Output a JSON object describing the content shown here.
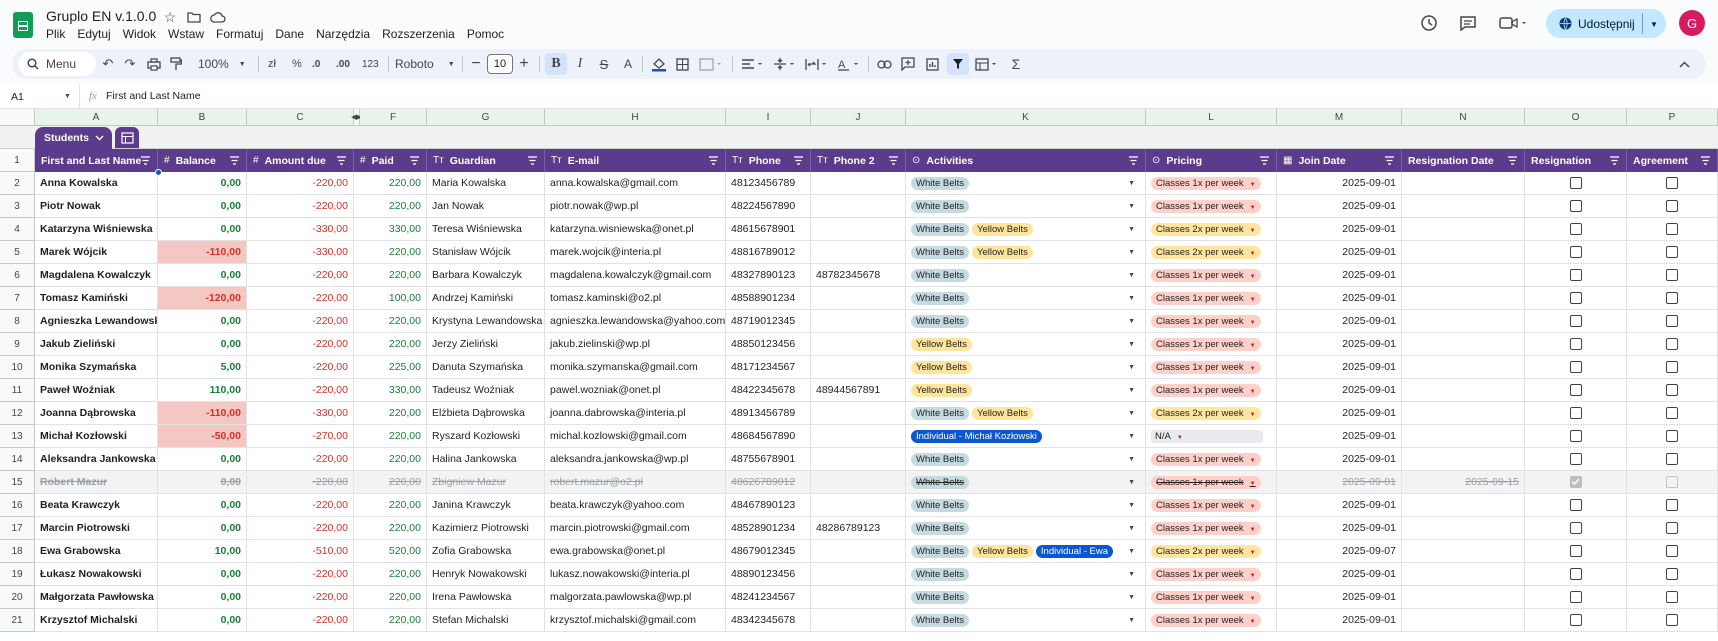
{
  "app": {
    "title": "Gruplo EN v.1.0.0",
    "share_label": "Udostępnij",
    "avatar_letter": "G",
    "menu": [
      "Plik",
      "Edytuj",
      "Widok",
      "Wstaw",
      "Formatuj",
      "Dane",
      "Narzędzia",
      "Rozszerzenia",
      "Pomoc"
    ]
  },
  "toolbar": {
    "search_label": "Menu",
    "zoom": "100%",
    "font": "Roboto",
    "font_size": "10",
    "currency": "zł",
    "percent": "%",
    "dec_less": ".0",
    "dec_more": ".00",
    "number_format": "123"
  },
  "formula": {
    "cell_ref": "A1",
    "fx": "fx",
    "content": "First and Last Name"
  },
  "sheet_tab": {
    "label": "Students"
  },
  "col_letters": [
    "A",
    "B",
    "C",
    "",
    "F",
    "G",
    "H",
    "I",
    "J",
    "K",
    "L",
    "M",
    "N",
    "O",
    "P"
  ],
  "headers": [
    "First and Last Name",
    "Balance",
    "Amount due",
    "Paid",
    "Guardian",
    "E-mail",
    "Phone",
    "Phone 2",
    "Activities",
    "Pricing",
    "Join Date",
    "Resignation Date",
    "Resignation",
    "Agreement"
  ],
  "header_icons": [
    "",
    "#",
    "#",
    "#",
    "Tт",
    "Tт",
    "Tт",
    "Tт",
    "⊙",
    "⊙",
    "▦",
    "",
    "",
    ""
  ],
  "rows": [
    {
      "n": "2",
      "name": "Anna Kowalska",
      "bal": "0,00",
      "due": "-220,00",
      "paid": "220,00",
      "guard": "Maria Kowalska",
      "email": "anna.kowalska@gmail.com",
      "ph": "48123456789",
      "ph2": "",
      "acts": [
        "White Belts"
      ],
      "price": "Classes 1x per week",
      "join": "2025-09-01",
      "resig": ""
    },
    {
      "n": "3",
      "name": "Piotr Nowak",
      "bal": "0,00",
      "due": "-220,00",
      "paid": "220,00",
      "guard": "Jan Nowak",
      "email": "piotr.nowak@wp.pl",
      "ph": "48224567890",
      "ph2": "",
      "acts": [
        "White Belts"
      ],
      "price": "Classes 1x per week",
      "join": "2025-09-01",
      "resig": ""
    },
    {
      "n": "4",
      "name": "Katarzyna Wiśniewska",
      "bal": "0,00",
      "due": "-330,00",
      "paid": "330,00",
      "guard": "Teresa Wiśniewska",
      "email": "katarzyna.wisniewska@onet.pl",
      "ph": "48615678901",
      "ph2": "",
      "acts": [
        "White Belts",
        "Yellow Belts"
      ],
      "price": "Classes 2x per week",
      "join": "2025-09-01",
      "resig": ""
    },
    {
      "n": "5",
      "name": "Marek Wójcik",
      "bal": "-110,00",
      "due": "-330,00",
      "paid": "220,00",
      "guard": "Stanisław Wójcik",
      "email": "marek.wojcik@interia.pl",
      "ph": "48816789012",
      "ph2": "",
      "acts": [
        "White Belts",
        "Yellow Belts"
      ],
      "price": "Classes 2x per week",
      "join": "2025-09-01",
      "resig": ""
    },
    {
      "n": "6",
      "name": "Magdalena Kowalczyk",
      "bal": "0,00",
      "due": "-220,00",
      "paid": "220,00",
      "guard": "Barbara Kowalczyk",
      "email": "magdalena.kowalczyk@gmail.com",
      "ph": "48327890123",
      "ph2": "48782345678",
      "acts": [
        "White Belts"
      ],
      "price": "Classes 1x per week",
      "join": "2025-09-01",
      "resig": ""
    },
    {
      "n": "7",
      "name": "Tomasz Kamiński",
      "bal": "-120,00",
      "due": "-220,00",
      "paid": "100,00",
      "guard": "Andrzej Kamiński",
      "email": "tomasz.kaminski@o2.pl",
      "ph": "48588901234",
      "ph2": "",
      "acts": [
        "White Belts"
      ],
      "price": "Classes 1x per week",
      "join": "2025-09-01",
      "resig": ""
    },
    {
      "n": "8",
      "name": "Agnieszka Lewandowska",
      "bal": "0,00",
      "due": "-220,00",
      "paid": "220,00",
      "guard": "Krystyna Lewandowska",
      "email": "agnieszka.lewandowska@yahoo.com",
      "ph": "48719012345",
      "ph2": "",
      "acts": [
        "White Belts"
      ],
      "price": "Classes 1x per week",
      "join": "2025-09-01",
      "resig": ""
    },
    {
      "n": "9",
      "name": "Jakub Zieliński",
      "bal": "0,00",
      "due": "-220,00",
      "paid": "220,00",
      "guard": "Jerzy Zieliński",
      "email": "jakub.zielinski@wp.pl",
      "ph": "48850123456",
      "ph2": "",
      "acts": [
        "Yellow Belts"
      ],
      "price": "Classes 1x per week",
      "join": "2025-09-01",
      "resig": ""
    },
    {
      "n": "10",
      "name": "Monika Szymańska",
      "bal": "5,00",
      "due": "-220,00",
      "paid": "225,00",
      "guard": "Danuta Szymańska",
      "email": "monika.szymanska@gmail.com",
      "ph": "48171234567",
      "ph2": "",
      "acts": [
        "Yellow Belts"
      ],
      "price": "Classes 1x per week",
      "join": "2025-09-01",
      "resig": ""
    },
    {
      "n": "11",
      "name": "Paweł Woźniak",
      "bal": "110,00",
      "due": "-220,00",
      "paid": "330,00",
      "guard": "Tadeusz Woźniak",
      "email": "pawel.wozniak@onet.pl",
      "ph": "48422345678",
      "ph2": "48944567891",
      "acts": [
        "Yellow Belts"
      ],
      "price": "Classes 1x per week",
      "join": "2025-09-01",
      "resig": ""
    },
    {
      "n": "12",
      "name": "Joanna Dąbrowska",
      "bal": "-110,00",
      "due": "-330,00",
      "paid": "220,00",
      "guard": "Elżbieta Dąbrowska",
      "email": "joanna.dabrowska@interia.pl",
      "ph": "48913456789",
      "ph2": "",
      "acts": [
        "White Belts",
        "Yellow Belts"
      ],
      "price": "Classes 2x per week",
      "join": "2025-09-01",
      "resig": ""
    },
    {
      "n": "13",
      "name": "Michał Kozłowski",
      "bal": "-50,00",
      "due": "-270,00",
      "paid": "220,00",
      "guard": "Ryszard Kozłowski",
      "email": "michal.kozlowski@gmail.com",
      "ph": "48684567890",
      "ph2": "",
      "acts": [
        "Individual - Michał Kozłowski"
      ],
      "price": "N/A",
      "join": "2025-09-01",
      "resig": ""
    },
    {
      "n": "14",
      "name": "Aleksandra Jankowska",
      "bal": "0,00",
      "due": "-220,00",
      "paid": "220,00",
      "guard": "Halina Jankowska",
      "email": "aleksandra.jankowska@wp.pl",
      "ph": "48755678901",
      "ph2": "",
      "acts": [
        "White Belts"
      ],
      "price": "Classes 1x per week",
      "join": "2025-09-01",
      "resig": ""
    },
    {
      "n": "15",
      "name": "Robert Mazur",
      "bal": "0,00",
      "due": "-220,00",
      "paid": "220,00",
      "guard": "Zbigniew Mazur",
      "email": "robert.mazur@o2.pl",
      "ph": "48626789012",
      "ph2": "",
      "acts": [
        "White Belts"
      ],
      "price": "Classes 1x per week",
      "join": "2025-09-01",
      "resig": "2025-09-15",
      "struck": true
    },
    {
      "n": "16",
      "name": "Beata Krawczyk",
      "bal": "0,00",
      "due": "-220,00",
      "paid": "220,00",
      "guard": "Janina Krawczyk",
      "email": "beata.krawczyk@yahoo.com",
      "ph": "48467890123",
      "ph2": "",
      "acts": [
        "White Belts"
      ],
      "price": "Classes 1x per week",
      "join": "2025-09-01",
      "resig": ""
    },
    {
      "n": "17",
      "name": "Marcin Piotrowski",
      "bal": "0,00",
      "due": "-220,00",
      "paid": "220,00",
      "guard": "Kazimierz Piotrowski",
      "email": "marcin.piotrowski@gmail.com",
      "ph": "48528901234",
      "ph2": "48286789123",
      "acts": [
        "White Belts"
      ],
      "price": "Classes 1x per week",
      "join": "2025-09-01",
      "resig": ""
    },
    {
      "n": "18",
      "name": "Ewa Grabowska",
      "bal": "10,00",
      "due": "-510,00",
      "paid": "520,00",
      "guard": "Zofia Grabowska",
      "email": "ewa.grabowska@onet.pl",
      "ph": "48679012345",
      "ph2": "",
      "acts": [
        "White Belts",
        "Yellow Belts",
        "Individual - Ewa"
      ],
      "price": "Classes 2x per week",
      "join": "2025-09-07",
      "resig": ""
    },
    {
      "n": "19",
      "name": "Łukasz Nowakowski",
      "bal": "0,00",
      "due": "-220,00",
      "paid": "220,00",
      "guard": "Henryk Nowakowski",
      "email": "lukasz.nowakowski@interia.pl",
      "ph": "48890123456",
      "ph2": "",
      "acts": [
        "White Belts"
      ],
      "price": "Classes 1x per week",
      "join": "2025-09-01",
      "resig": ""
    },
    {
      "n": "20",
      "name": "Małgorzata Pawłowska",
      "bal": "0,00",
      "due": "-220,00",
      "paid": "220,00",
      "guard": "Irena Pawłowska",
      "email": "malgorzata.pawlowska@wp.pl",
      "ph": "48241234567",
      "ph2": "",
      "acts": [
        "White Belts"
      ],
      "price": "Classes 1x per week",
      "join": "2025-09-01",
      "resig": ""
    },
    {
      "n": "21",
      "name": "Krzysztof Michalski",
      "bal": "0,00",
      "due": "-220,00",
      "paid": "220,00",
      "guard": "Stefan Michalski",
      "email": "krzysztof.michalski@gmail.com",
      "ph": "48342345678",
      "ph2": "",
      "acts": [
        "White Belts"
      ],
      "price": "Classes 1x per week",
      "join": "2025-09-01",
      "resig": ""
    }
  ],
  "colors": {
    "header_purple": "#5b3c8c",
    "green": "#188038",
    "red": "#d93025",
    "neg_bg": "#f4c7c3",
    "white_chip": "#c6dbe1",
    "yellow_chip": "#ffe59b",
    "indiv_chip": "#0b57d0",
    "price1_bg": "#ffcfc9",
    "price2_bg": "#ffe5a0",
    "share_bg": "#c2e7ff"
  }
}
